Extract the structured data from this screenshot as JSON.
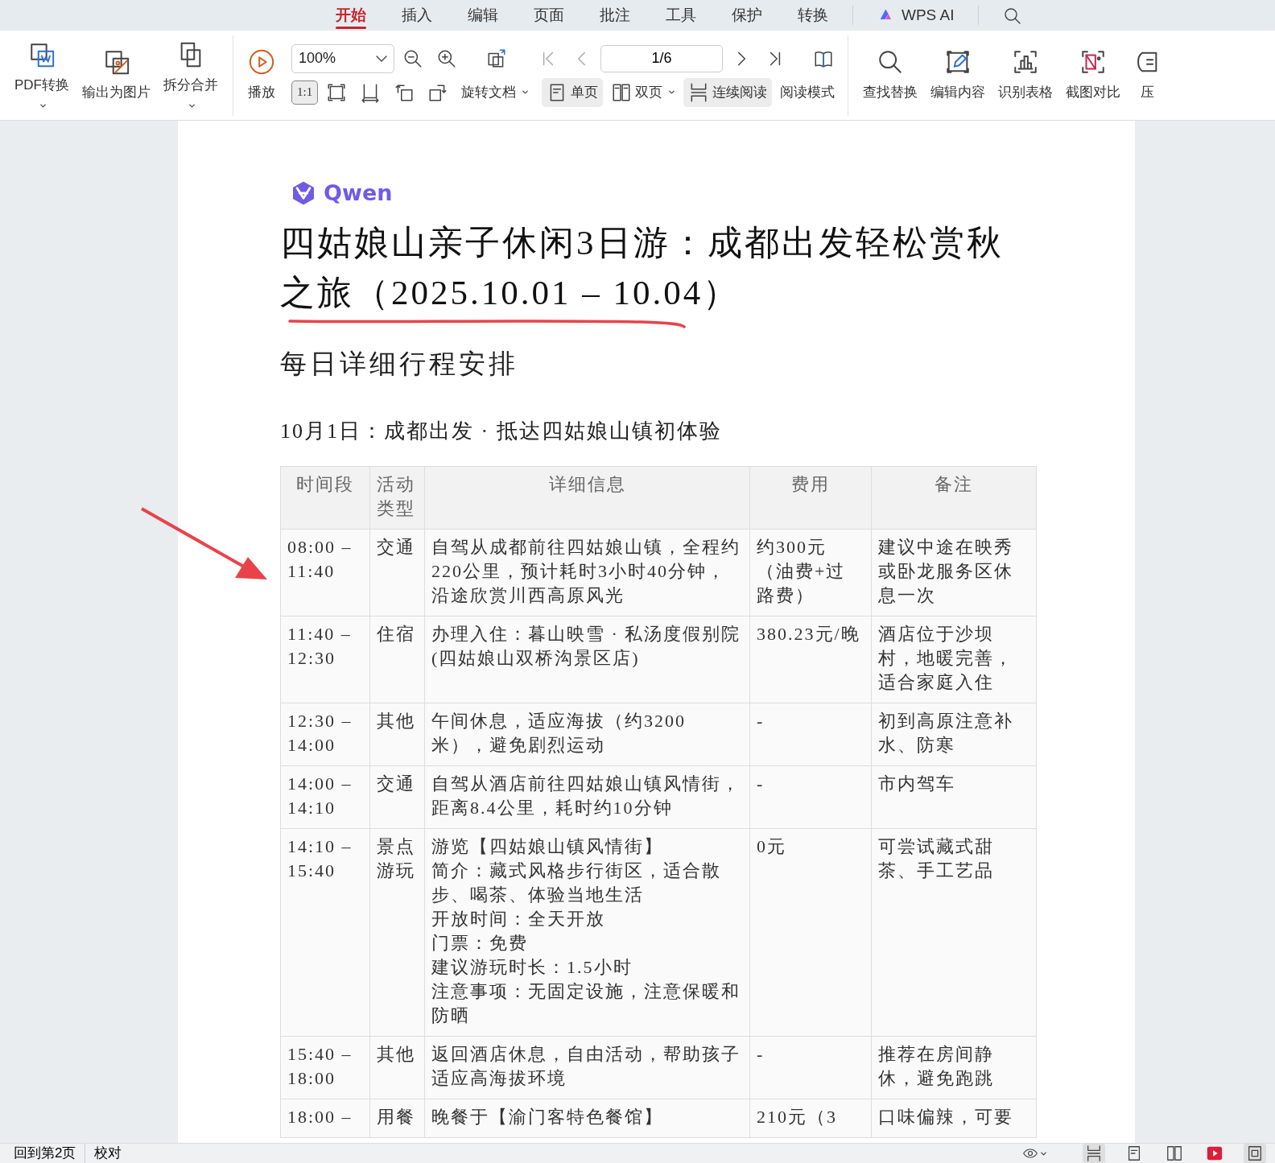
{
  "tabs": [
    {
      "label": "开始",
      "selected": true
    },
    {
      "label": "插入",
      "selected": false
    },
    {
      "label": "编辑",
      "selected": false
    },
    {
      "label": "页面",
      "selected": false
    },
    {
      "label": "批注",
      "selected": false
    },
    {
      "label": "工具",
      "selected": false
    },
    {
      "label": "保护",
      "selected": false
    },
    {
      "label": "转换",
      "selected": false
    }
  ],
  "ai_tab": {
    "label": "WPS AI"
  },
  "toolbar": {
    "file_buttons": [
      {
        "label": "PDF转换",
        "dropdown": true
      },
      {
        "label": "输出为图片",
        "dropdown": false
      },
      {
        "label": "拆分合并",
        "dropdown": true
      }
    ],
    "play": {
      "label": "播放"
    },
    "zoom": {
      "value": "100%"
    },
    "page": {
      "value": "1/6"
    },
    "actual_size": {
      "label": "1:1",
      "selected": true
    },
    "rotate": {
      "label": "旋转文档",
      "dropdown": true
    },
    "view_buttons": [
      {
        "label": "单页",
        "selected": true,
        "dropdown": false
      },
      {
        "label": "双页",
        "selected": false,
        "dropdown": true
      },
      {
        "label": "连续阅读",
        "selected": true,
        "dropdown": false
      }
    ],
    "read_mode": {
      "label": "阅读模式"
    },
    "tool_buttons": [
      {
        "label": "查找替换"
      },
      {
        "label": "编辑内容"
      },
      {
        "label": "识别表格"
      },
      {
        "label": "截图对比"
      },
      {
        "label": "压"
      }
    ]
  },
  "document": {
    "logo": "Qwen",
    "title": "四姑娘山亲子休闲3日游：成都出发轻松赏秋之旅（2025.10.01 – 10.04）",
    "heading": "每日详细行程安排",
    "day_title": "10月1日：成都出发 · 抵达四姑娘山镇初体验",
    "table": {
      "columns": [
        "时间段",
        "活动类型",
        "详细信息",
        "费用",
        "备注"
      ],
      "rows": [
        [
          "08:00 – 11:40",
          "交通",
          "自驾从成都前往四姑娘山镇，全程约220公里，预计耗时3小时40分钟，沿途欣赏川西高原风光",
          "约300元（油费+过路费）",
          "建议中途在映秀或卧龙服务区休息一次"
        ],
        [
          "11:40 – 12:30",
          "住宿",
          "办理入住：暮山映雪 · 私汤度假别院(四姑娘山双桥沟景区店)",
          "380.23元/晚",
          "酒店位于沙坝村，地暖完善，适合家庭入住"
        ],
        [
          "12:30 – 14:00",
          "其他",
          "午间休息，适应海拔（约3200米），避免剧烈运动",
          "-",
          "初到高原注意补水、防寒"
        ],
        [
          "14:00 – 14:10",
          "交通",
          "自驾从酒店前往四姑娘山镇风情街，距离8.4公里，耗时约10分钟",
          "-",
          "市内驾车"
        ],
        [
          "14:10 – 15:40",
          "景点游玩",
          [
            "游览【四姑娘山镇风情街】",
            "简介：藏式风格步行街区，适合散步、喝茶、体验当地生活",
            "开放时间：全天开放",
            "门票：免费",
            "建议游玩时长：1.5小时",
            "注意事项：无固定设施，注意保暖和防晒"
          ],
          "0元",
          "可尝试藏式甜茶、手工艺品"
        ],
        [
          "15:40 – 18:00",
          "其他",
          "返回酒店休息，自由活动，帮助孩子适应高海拔环境",
          "-",
          "推荐在房间静休，避免跑跳"
        ],
        [
          "18:00 –",
          "用餐",
          "晚餐于【渝门客特色餐馆】",
          "210元（3",
          "口味偏辣，可要"
        ]
      ]
    }
  },
  "status_bar": {
    "back_link": "回到第2页",
    "proofread": "校对",
    "views": [
      {
        "selected": true
      },
      {
        "selected": false
      },
      {
        "selected": false
      },
      {
        "selected": false
      },
      {
        "selected": true
      }
    ]
  }
}
